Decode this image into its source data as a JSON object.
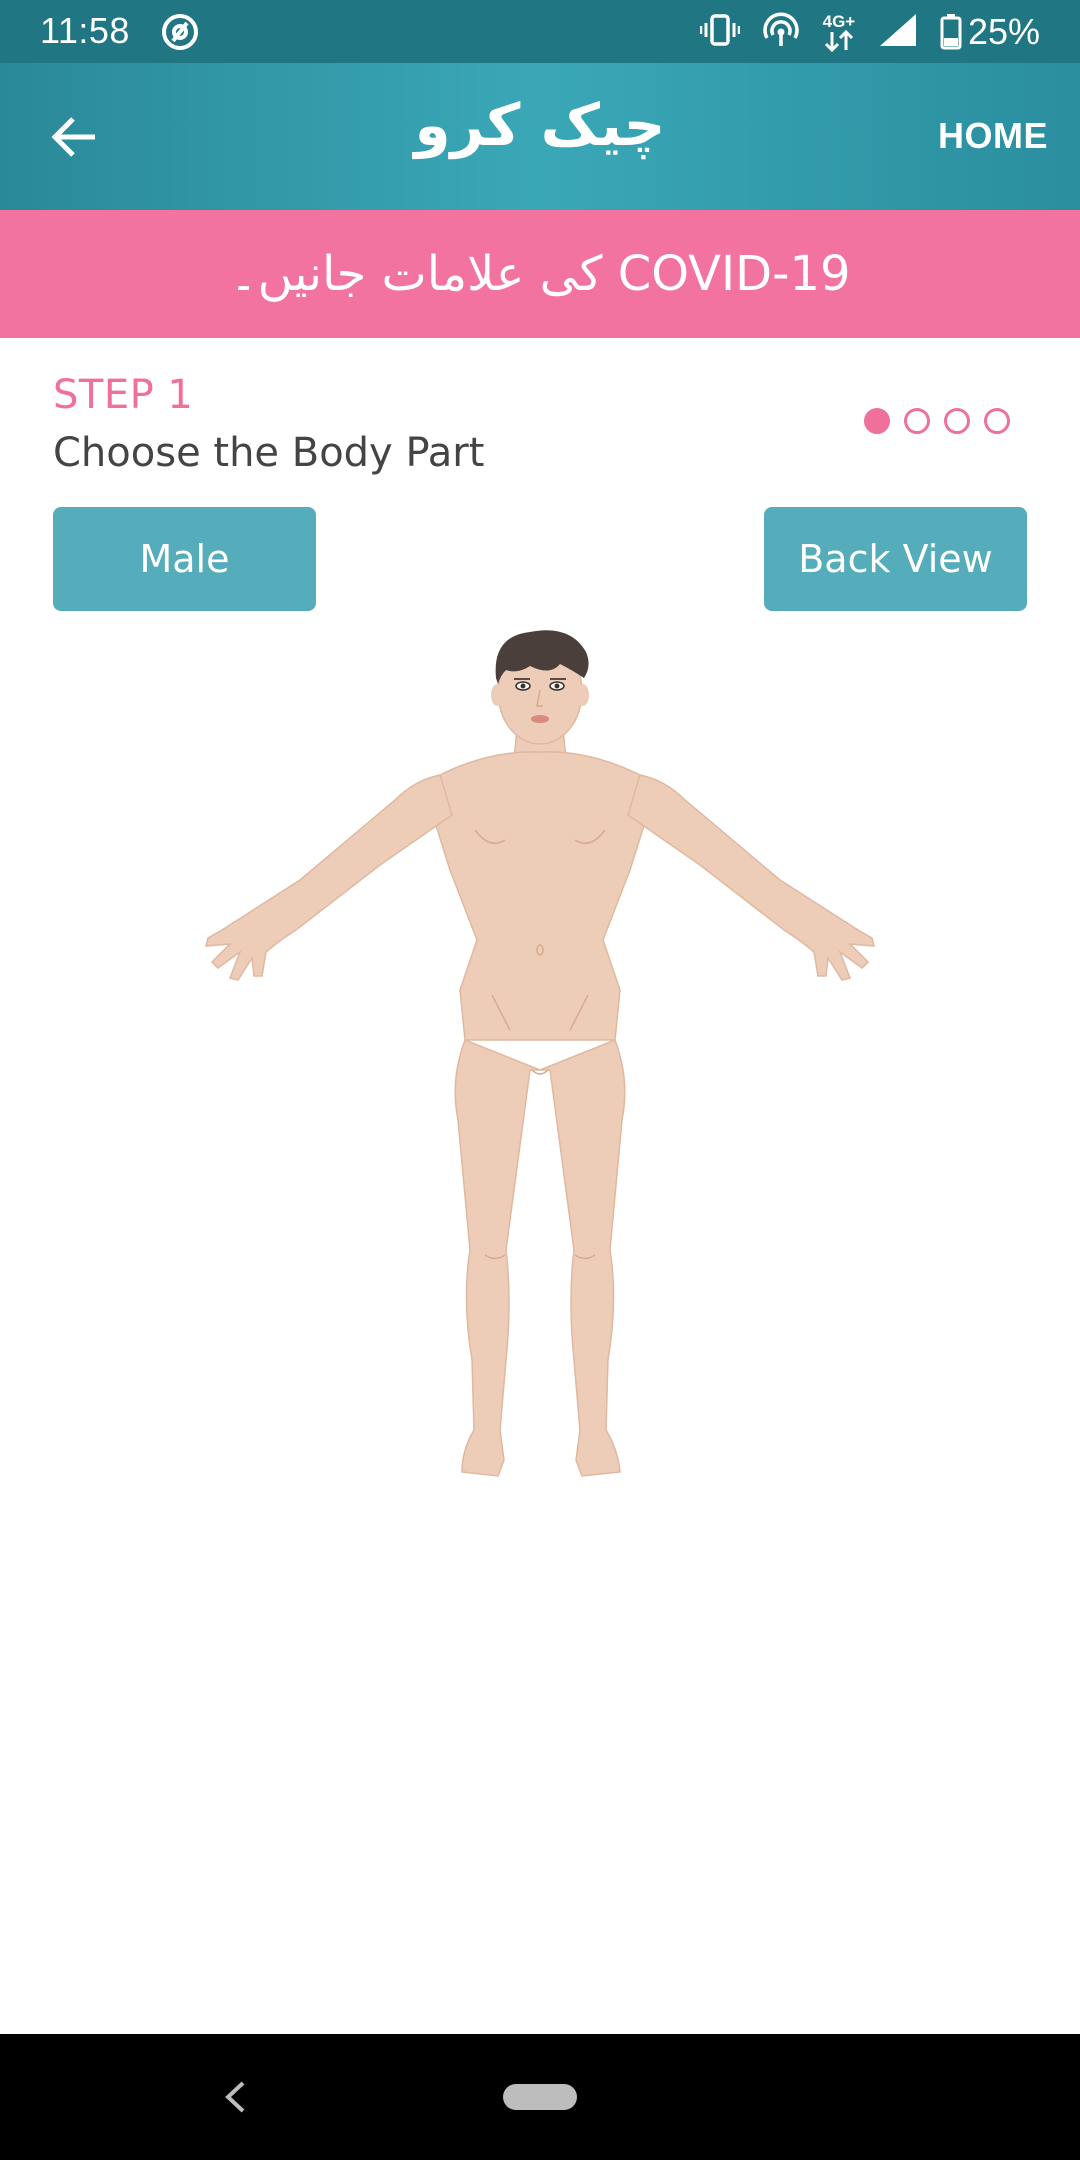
{
  "status_bar": {
    "time": "11:58",
    "network": "4G+",
    "battery_percent": "25%",
    "icons": [
      "at-sign-icon",
      "vibrate-icon",
      "hotspot-icon",
      "network-arrows-icon",
      "signal-icon",
      "battery-icon"
    ]
  },
  "app_bar": {
    "title": "چیک کرو",
    "home_label": "HOME",
    "back_icon": "arrow-left-icon"
  },
  "banner": {
    "text": "COVID-19 کی علامات جانیں۔"
  },
  "step": {
    "label": "STEP 1",
    "subtitle": "Choose the Body Part",
    "total_steps": 4,
    "current_step": 1
  },
  "buttons": {
    "gender": "Male",
    "view": "Back View"
  },
  "figure": {
    "icon": "human-body-front-figure"
  },
  "colors": {
    "status_bar": "#217684",
    "app_bar": "#3aa7b7",
    "banner": "#f272a0",
    "accent_pink": "#f0709c",
    "button": "#55adbb",
    "skin": "#eecdb8",
    "hair": "#4a3f3a"
  }
}
